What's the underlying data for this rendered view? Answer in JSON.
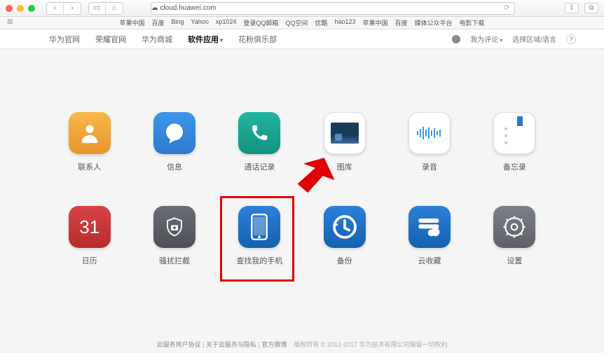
{
  "browser": {
    "url": "☁ cloud.huawei.com",
    "bookmarks": [
      "苹果中国",
      "百度",
      "Bing",
      "Yahoo",
      "xp1024",
      "登录QQ邮箱",
      "QQ空间",
      "优酷",
      "hao123",
      "苹果中国",
      "百度",
      "媒体公众平台",
      "电影下载"
    ]
  },
  "nav": {
    "items": [
      "华为官网",
      "荣耀官网",
      "华为商城",
      "软件应用",
      "花粉俱乐部"
    ],
    "active_index": 3,
    "user": "我为评论",
    "region": "选择区域/语言"
  },
  "apps": {
    "row1": [
      {
        "label": "联系人",
        "key": "contacts"
      },
      {
        "label": "信息",
        "key": "msg"
      },
      {
        "label": "通话记录",
        "key": "call"
      },
      {
        "label": "图库",
        "key": "gallery"
      },
      {
        "label": "录音",
        "key": "record"
      },
      {
        "label": "备忘录",
        "key": "notes"
      }
    ],
    "row2": [
      {
        "label": "日历",
        "key": "cal",
        "num": "31"
      },
      {
        "label": "骚扰拦截",
        "key": "block"
      },
      {
        "label": "查找我的手机",
        "key": "find",
        "highlight": true
      },
      {
        "label": "备份",
        "key": "backup"
      },
      {
        "label": "云收藏",
        "key": "cloud"
      },
      {
        "label": "设置",
        "key": "settings"
      }
    ]
  },
  "footer": {
    "links": [
      "云服务用户协议",
      "关于云服务与隐私",
      "官方微博"
    ],
    "copy": "版权所有 © 2012-2017 华为技术有限公司保留一切权利"
  }
}
